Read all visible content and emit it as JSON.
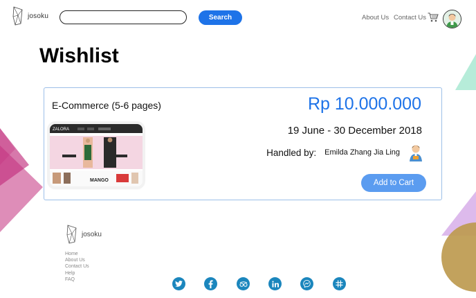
{
  "header": {
    "logo_text": "josoku",
    "search": {
      "value": "",
      "placeholder": ""
    },
    "search_button_label": "Search",
    "nav": {
      "about": "About Us",
      "contact": "Contact Us"
    },
    "icons": {
      "cart": "cart-icon",
      "avatar": "user-avatar"
    }
  },
  "page": {
    "title": "Wishlist"
  },
  "wishlist": {
    "items": [
      {
        "name": "E-Commerce (5-6 pages)",
        "price": "Rp 10.000.000",
        "dates": "19 June - 30 December 2018",
        "handled_label": "Handled by:",
        "handler": "Emilda Zhang Jia Ling",
        "thumbnail": {
          "brand": "ZALORA",
          "promo_brand": "MANGO"
        },
        "add_to_cart_label": "Add to Cart"
      }
    ]
  },
  "footer": {
    "logo_text": "josoku",
    "links": [
      "Home",
      "About Us",
      "Contact Us",
      "Help",
      "FAQ"
    ],
    "social": [
      "twitter-icon",
      "facebook-icon",
      "tripadvisor-icon",
      "linkedin-icon",
      "messenger-icon",
      "slack-icon"
    ]
  },
  "colors": {
    "primary": "#1e73e8",
    "button_light": "#5b9cf0",
    "card_border": "#9cbfe8",
    "social": "#1b86bd",
    "deco_pink": "#c2307e",
    "deco_mint": "#b6ecd9",
    "deco_lavender": "#d9b2ea",
    "deco_gold": "#bd9a4f"
  }
}
